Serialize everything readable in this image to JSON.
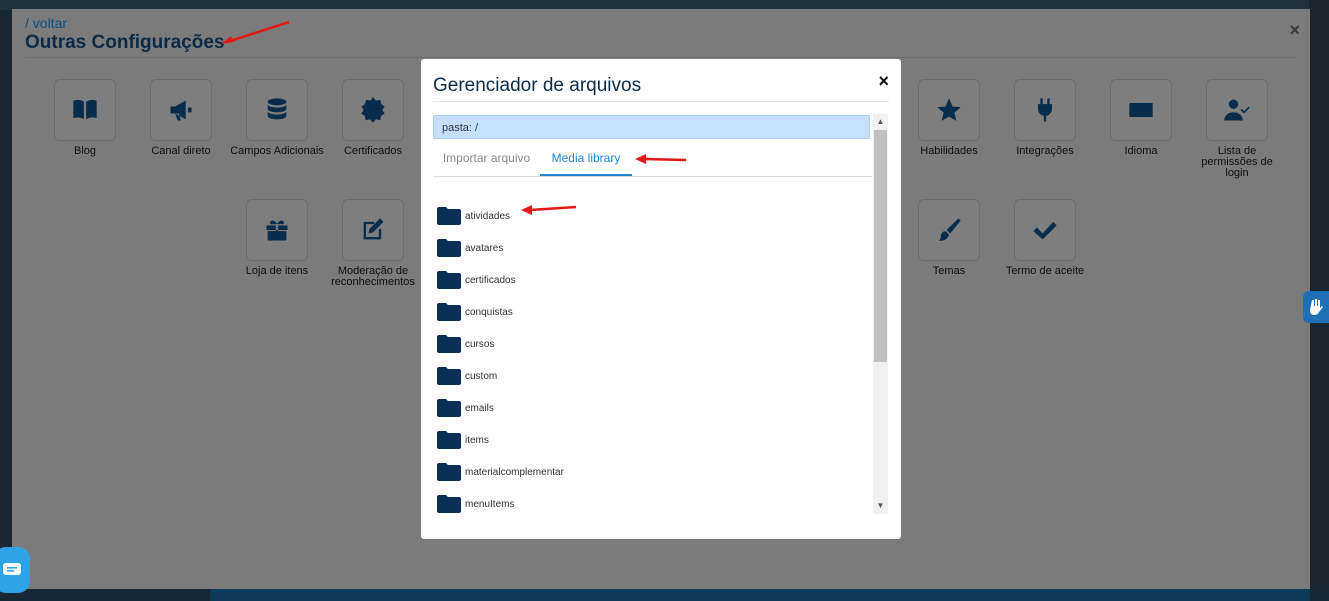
{
  "panel": {
    "back_link": "/ voltar",
    "title": "Outras Configurações",
    "close": "×",
    "items": [
      {
        "label": "Blog",
        "icon": "book-icon"
      },
      {
        "label": "Canal direto",
        "icon": "megaphone-icon"
      },
      {
        "label": "Campos Adicionais",
        "icon": "database-icon"
      },
      {
        "label": "Certificados",
        "icon": "certificate-icon"
      },
      {
        "label": "Habilidades",
        "icon": "star-icon"
      },
      {
        "label": "Integrações",
        "icon": "plug-icon"
      },
      {
        "label": "Idioma",
        "icon": "language-icon"
      },
      {
        "label": "Lista de permissões de login",
        "icon": "user-check-icon"
      },
      {
        "label": "Loja de itens",
        "icon": "gift-icon"
      },
      {
        "label": "Moderação de reconhecimentos",
        "icon": "edit-icon"
      },
      {
        "label": "Temas",
        "icon": "brush-icon"
      },
      {
        "label": "Termo de aceite",
        "icon": "check-icon"
      }
    ]
  },
  "modal": {
    "title": "Gerenciador de arquivos",
    "close": "×",
    "path": "pasta: /",
    "tabs": [
      {
        "label": "Importar arquivo",
        "active": false
      },
      {
        "label": "Media library",
        "active": true
      }
    ],
    "folders": [
      "atividades",
      "avatares",
      "certificados",
      "conquistas",
      "cursos",
      "custom",
      "emails",
      "items",
      "materialcomplementar",
      "menuItems"
    ]
  },
  "colors": {
    "accent": "#2086d0",
    "folder": "#0c2f57",
    "annotation_arrow": "#e01818",
    "path_bar": "#c6dffc"
  }
}
